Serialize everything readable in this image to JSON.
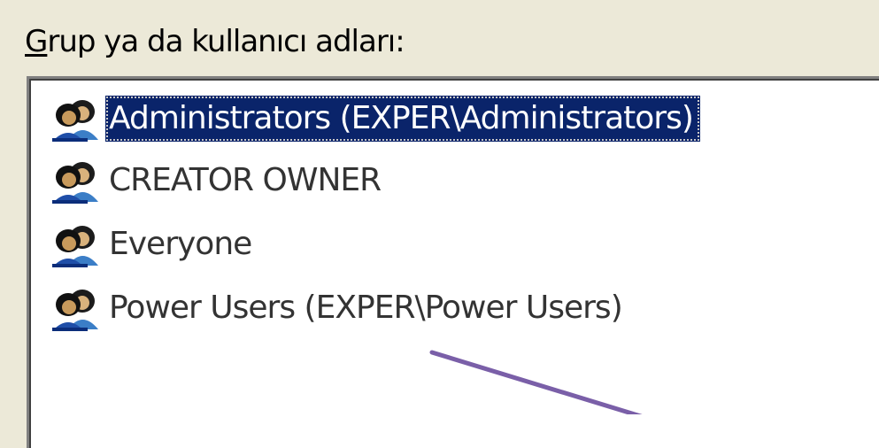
{
  "group_label": {
    "accelerator": "G",
    "rest": "rup ya da kullanıcı adları:"
  },
  "principals": [
    {
      "label": "Administrators (EXPER\\Administrators)",
      "icon": "users-group-icon",
      "selected": true
    },
    {
      "label": "CREATOR OWNER",
      "icon": "users-group-icon",
      "selected": false
    },
    {
      "label": "Everyone",
      "icon": "users-group-icon",
      "selected": false
    },
    {
      "label": "Power Users (EXPER\\Power Users)",
      "icon": "users-group-icon",
      "selected": false
    }
  ],
  "colors": {
    "selection_background": "#0a246a",
    "dialog_background": "#ece9d8",
    "annotation_arrow": "#7a5fa8"
  }
}
